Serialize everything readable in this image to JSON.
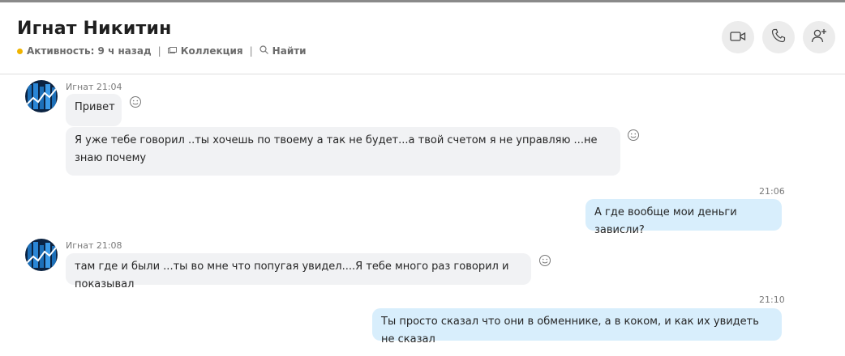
{
  "header": {
    "contact_name": "Игнат Никитин",
    "activity": "Активность: 9 ч назад",
    "separator": "|",
    "collection": "Коллекция",
    "search": "Найти"
  },
  "messages": [
    {
      "sender": "Игнат 21:04",
      "text": "Привет"
    },
    {
      "text": "Я уже тебе говорил ..ты хочешь по твоему  а так не будет...а твой счетом я не управляю ...не знаю почему"
    },
    {
      "time": "21:06",
      "text": "А где вообще мои деньги зависли?"
    },
    {
      "sender": "Игнат 21:08",
      "text": "там где и были ...ты во мне что попугая увидел....Я тебе много раз говорил и показывал"
    },
    {
      "time": "21:10",
      "text": "Ты просто сказал что они в обменнике, а в коком, и как их увидеть не сказал"
    }
  ],
  "colors": {
    "incoming_bubble": "#f1f2f4",
    "outgoing_bubble": "#d8eefc",
    "presence_away": "#f0b400"
  },
  "icons": [
    "video-call-icon",
    "phone-icon",
    "add-person-icon",
    "emoji-reaction-icon",
    "collection-icon",
    "search-icon"
  ]
}
